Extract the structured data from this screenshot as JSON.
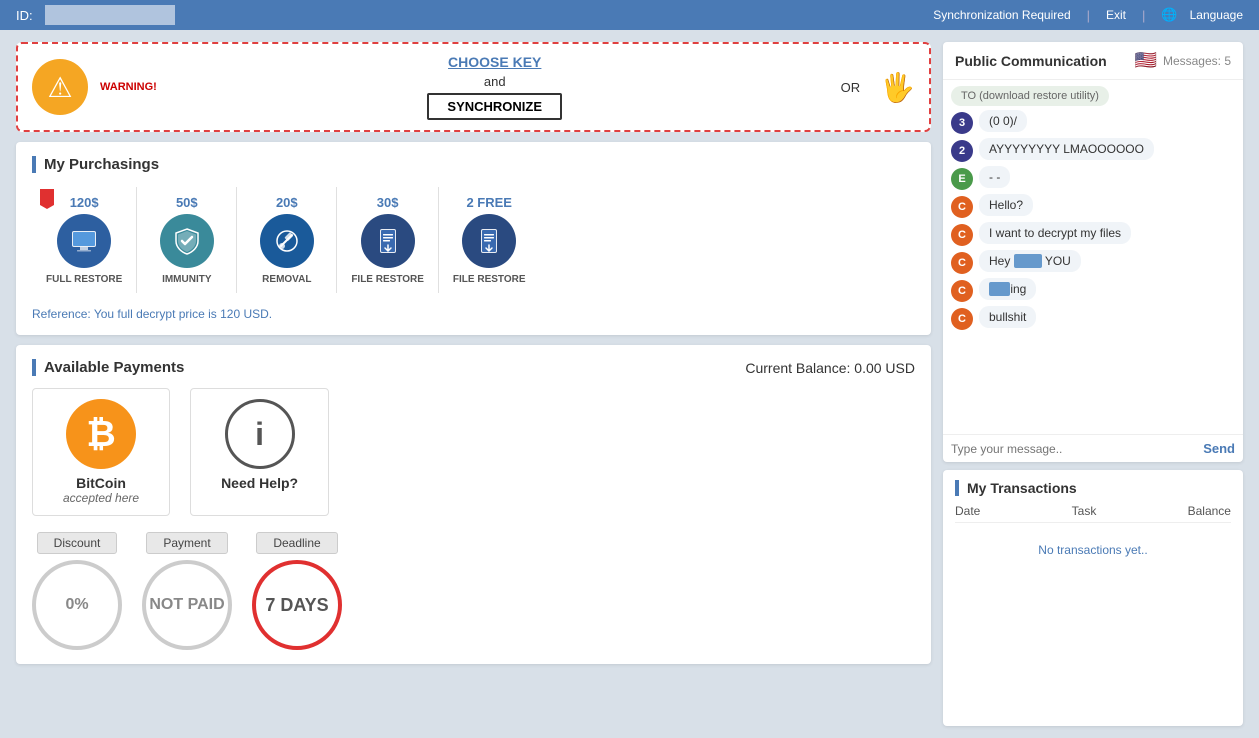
{
  "topbar": {
    "id_label": "ID:",
    "id_value": "",
    "sync_required": "Synchronization Required",
    "exit": "Exit",
    "language": "Language"
  },
  "warning": {
    "warning_text": "WARNING!",
    "choose_key": "CHOOSE KEY",
    "and": "and",
    "synchronize": "SYNCHRONIZE",
    "or": "OR"
  },
  "purchasings": {
    "title": "My Purchasings",
    "reference": "Reference: You full decrypt price is 120 USD.",
    "products": [
      {
        "price": "120$",
        "label": "FULL RESTORE",
        "icon": "laptop",
        "has_ribbon": true
      },
      {
        "price": "50$",
        "label": "IMMUNITY",
        "icon": "shield",
        "has_ribbon": false
      },
      {
        "price": "20$",
        "label": "REMOVAL",
        "icon": "wrench",
        "has_ribbon": false
      },
      {
        "price": "30$",
        "label": "FILE RESTORE",
        "icon": "file",
        "has_ribbon": false
      },
      {
        "price": "2 FREE",
        "label": "FILE RESTORE",
        "icon": "file2",
        "has_ribbon": false,
        "is_free": true
      }
    ]
  },
  "payments": {
    "title": "Available Payments",
    "balance_label": "Current Balance:",
    "balance_value": "0.00 USD",
    "bitcoin": {
      "name": "BitCoin",
      "sub": "accepted here"
    },
    "help": {
      "name": "Need Help?"
    },
    "discount_label": "Discount",
    "payment_label": "Payment",
    "deadline_label": "Deadline",
    "discount_value": "0%",
    "payment_value": "NOT PAID",
    "deadline_value": "7 DAYS"
  },
  "chat": {
    "title": "Public Communication",
    "messages_label": "Messages: 5",
    "input_placeholder": "Type your message..",
    "send_label": "Send",
    "messages": [
      {
        "avatar": "3",
        "color": "#3a3a8a",
        "text": "(0  0)/"
      },
      {
        "avatar": "2",
        "color": "#3a3a8a",
        "text": "AYYYYYYYY LMAOOOOOO"
      },
      {
        "avatar": "E",
        "color": "#4a9a4a",
        "text": "- -"
      },
      {
        "avatar": "C",
        "color": "#e06020",
        "text": "Hello?"
      },
      {
        "avatar": "C",
        "color": "#e06020",
        "text": "I want to decrypt my files"
      },
      {
        "avatar": "C",
        "color": "#e06020",
        "text": "Hey [REDACTED] YOU",
        "has_redacted": true,
        "redacted_pos": "mid"
      },
      {
        "avatar": "C",
        "color": "#e06020",
        "text": "[REDACTED]ing",
        "has_redacted": true,
        "redacted_pos": "start"
      },
      {
        "avatar": "C",
        "color": "#e06020",
        "text": "bullshit"
      }
    ]
  },
  "transactions": {
    "title": "My Transactions",
    "col_date": "Date",
    "col_task": "Task",
    "col_balance": "Balance",
    "empty_text": "No transactions yet.."
  }
}
